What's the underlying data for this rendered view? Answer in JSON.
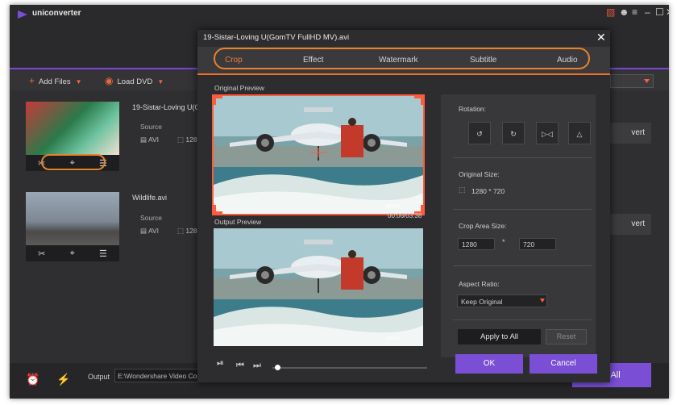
{
  "app": {
    "title": "uniconverter"
  },
  "toolbar": {
    "add_files": "Add Files",
    "load_dvd": "Load DVD"
  },
  "files": [
    {
      "name": "19-Sistar-Loving U(Go",
      "source_label": "Source",
      "format": "AVI",
      "resolution": "128",
      "convert_label": "vert"
    },
    {
      "name": "Wildlife.avi",
      "source_label": "Source",
      "format": "AVI",
      "resolution": "128",
      "convert_label": "vert"
    }
  ],
  "bottom": {
    "output_label": "Output",
    "output_path": "E:\\Wondershare Video Co",
    "convert_all": "rt All"
  },
  "dialog": {
    "title": "19-Sistar-Loving U(GomTV FullHD MV).avi",
    "tabs": [
      {
        "label": "Crop",
        "active": true
      },
      {
        "label": "Effect",
        "active": false
      },
      {
        "label": "Watermark",
        "active": false
      },
      {
        "label": "Subtitle",
        "active": false
      },
      {
        "label": "Audio",
        "active": false
      }
    ],
    "original_preview": "Original Preview",
    "output_preview": "Output Preview",
    "timecode": "00:06/03:38",
    "rotation_label": "Rotation:",
    "rotation_icons": [
      "rotate-left-90-icon",
      "rotate-right-90-icon",
      "flip-horizontal-icon",
      "flip-vertical-icon"
    ],
    "original_size_label": "Original Size:",
    "original_size": "1280 * 720",
    "crop_area_label": "Crop Area Size:",
    "crop_width": "1280",
    "crop_times": "*",
    "crop_height": "720",
    "aspect_label": "Aspect Ratio:",
    "aspect_value": "Keep Original",
    "apply_all": "Apply to All",
    "reset": "Reset",
    "ok": "OK",
    "cancel": "Cancel",
    "watermark_text": "gomtv"
  },
  "colors": {
    "accent": "#7a4fd6",
    "highlight": "#e8832a",
    "crop_frame": "#ff5a3c"
  }
}
